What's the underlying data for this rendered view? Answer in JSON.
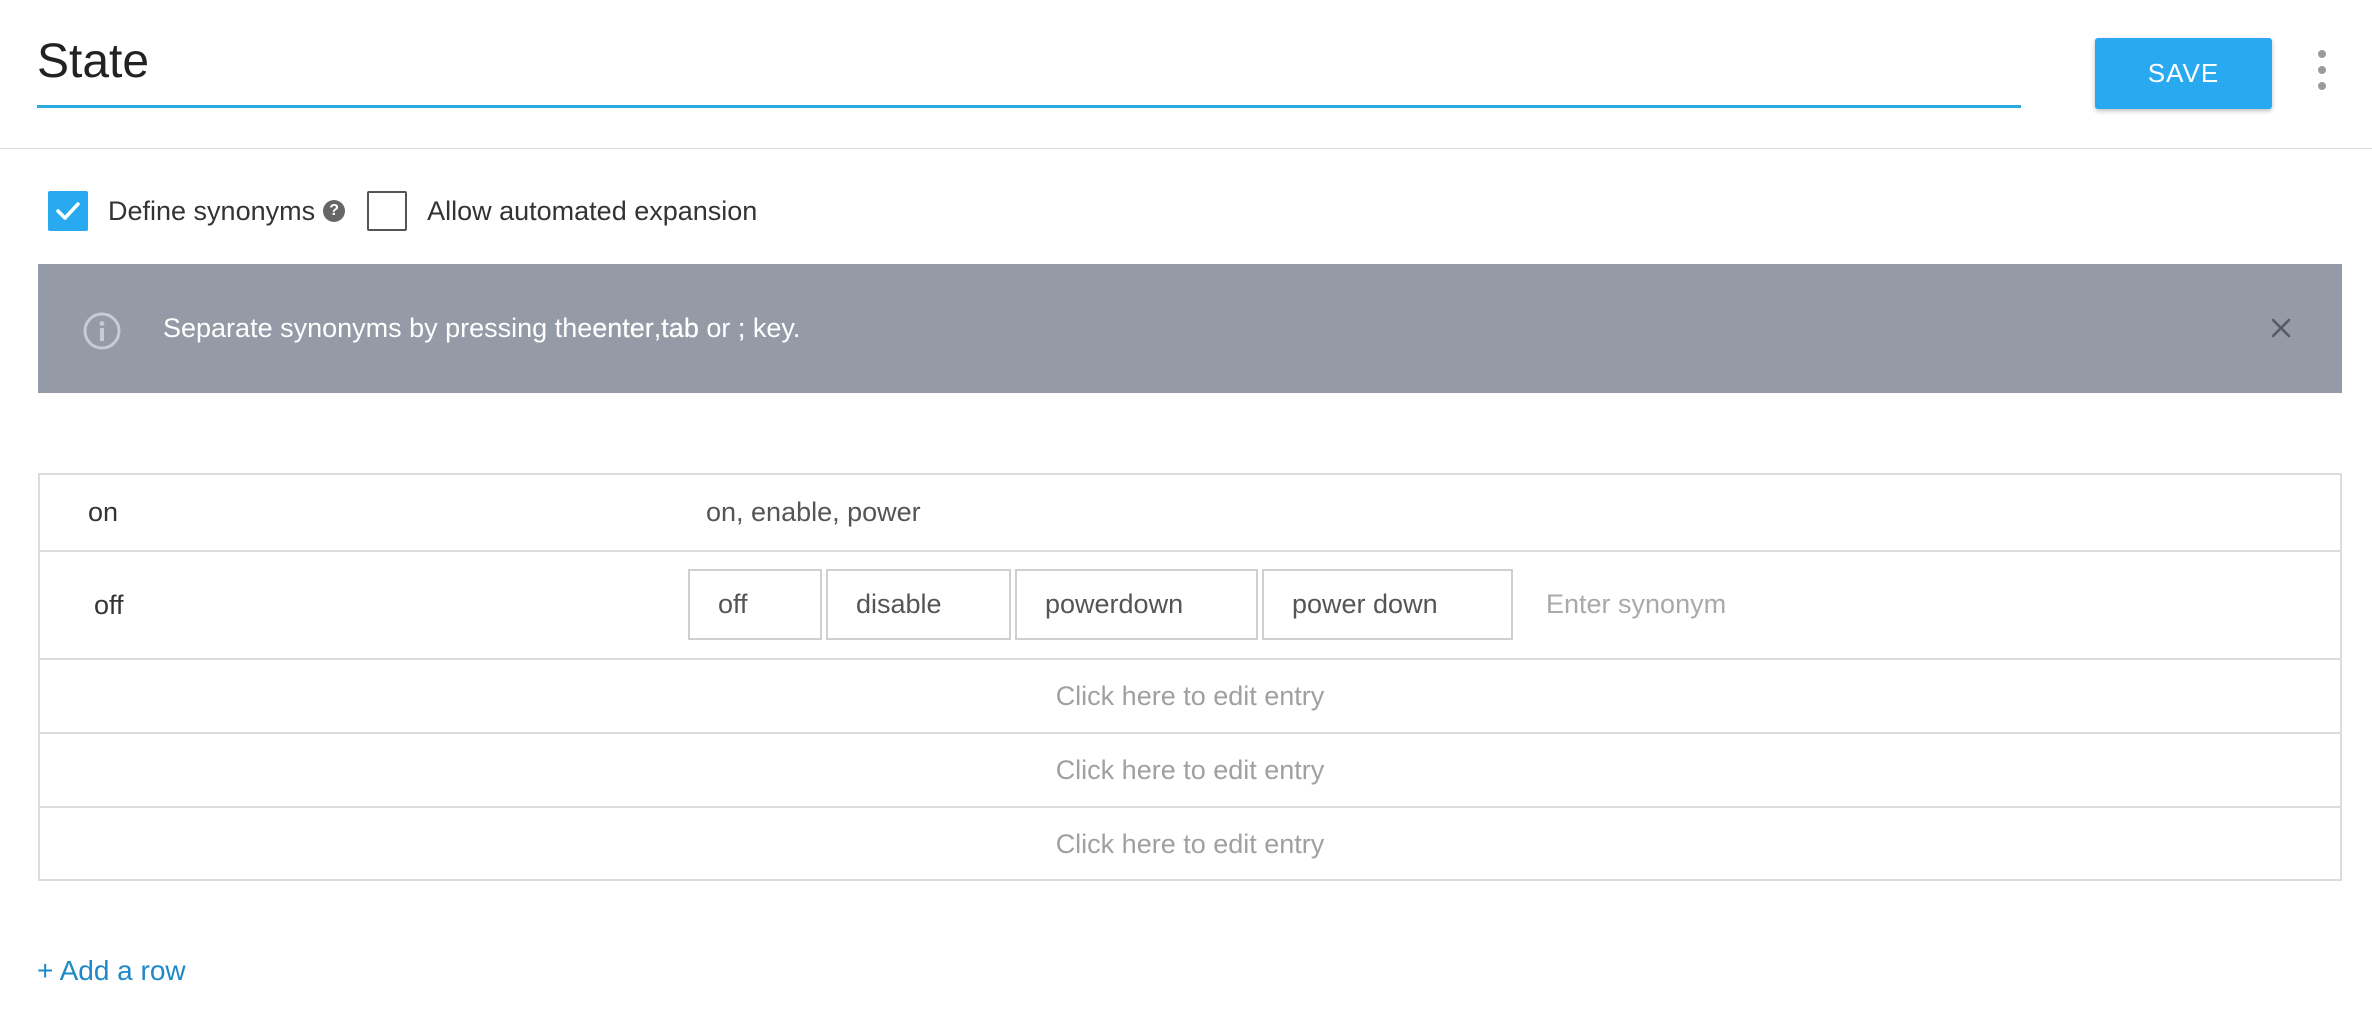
{
  "header": {
    "entity_name": "State",
    "save_label": "SAVE",
    "more_menu_icon": "more-vertical-icon"
  },
  "options": {
    "define_synonyms": {
      "label": "Define synonyms",
      "checked": true
    },
    "help_icon_glyph": "?",
    "automated_expansion": {
      "label": "Allow automated expansion",
      "checked": false
    }
  },
  "banner": {
    "text_before": "Separate synonyms by pressing the ",
    "key1": "enter",
    "sep1": ", ",
    "key2": "tab",
    "sep2": " or ",
    "key3": ";",
    "text_after": " key.",
    "icon": "info-icon",
    "close_icon": "close-icon",
    "background": "#949ba7"
  },
  "entries": [
    {
      "reference_value": "on",
      "synonyms_text": "on, enable, power"
    },
    {
      "reference_value": "off",
      "synonyms": [
        "off",
        "disable",
        "powerdown",
        "power down"
      ],
      "synonym_placeholder": "Enter synonym"
    }
  ],
  "empty_rows": [
    {
      "label": "Click here to edit entry"
    },
    {
      "label": "Click here to edit entry"
    },
    {
      "label": "Click here to edit entry"
    }
  ],
  "add_row_label": "+ Add a row",
  "colors": {
    "accent": "#29aaf0",
    "link": "#1e88c8",
    "underline": "#29a9e0"
  }
}
